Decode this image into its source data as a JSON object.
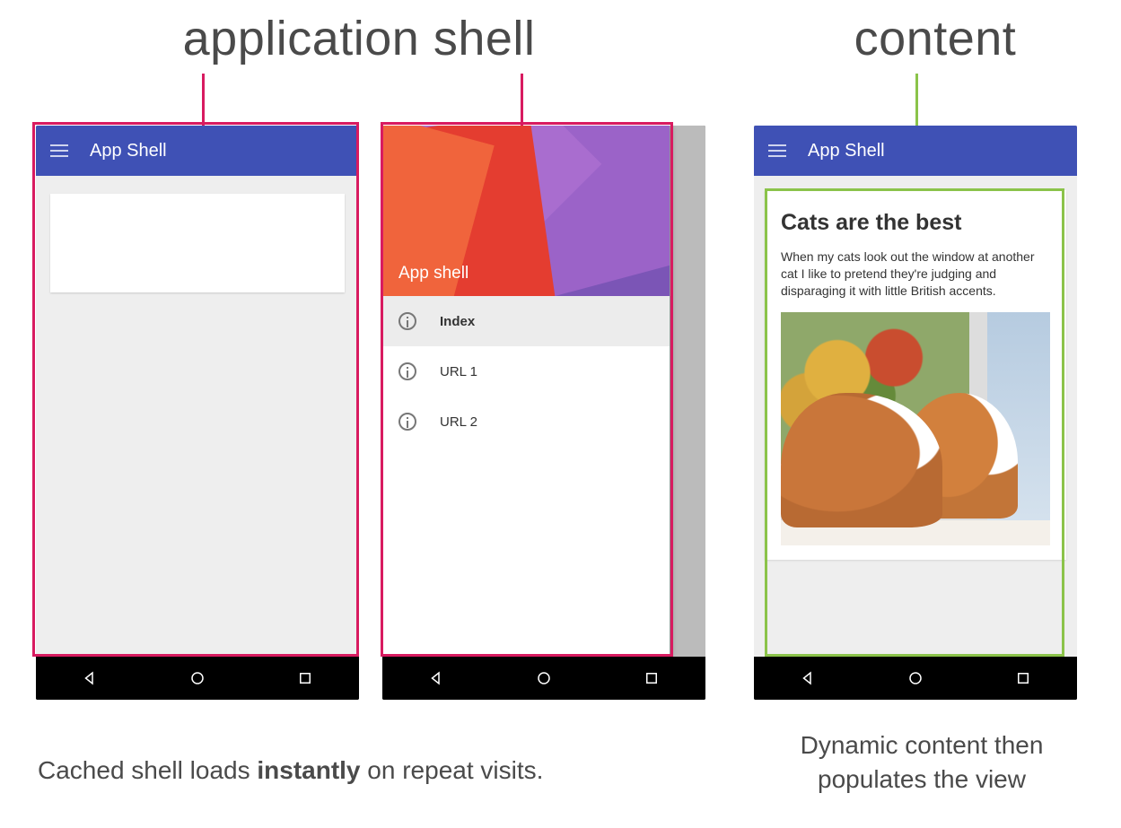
{
  "headings": {
    "shell": "application shell",
    "content": "content"
  },
  "appbar_title": "App Shell",
  "drawer": {
    "header_title": "App shell",
    "items": [
      {
        "label": "Index",
        "selected": true
      },
      {
        "label": "URL 1",
        "selected": false
      },
      {
        "label": "URL 2",
        "selected": false
      }
    ]
  },
  "content_card": {
    "title": "Cats are the best",
    "body": "When my cats look out the window at another cat I like to pretend they're judging and disparaging it with little British accents."
  },
  "captions": {
    "left_pre": "Cached shell loads ",
    "left_bold": "instantly",
    "left_post": " on repeat visits.",
    "right": "Dynamic content then populates the view"
  }
}
